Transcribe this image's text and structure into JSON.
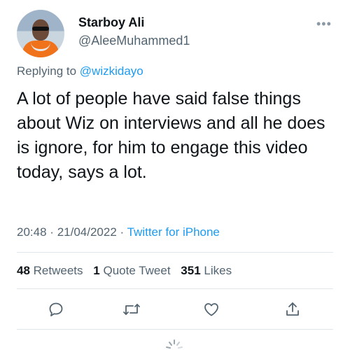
{
  "tweet": {
    "author": {
      "display_name": "Starboy Ali",
      "handle": "@AleeMuhammed1"
    },
    "replying_to": {
      "prefix": "Replying to",
      "mention": "@wizkidayo"
    },
    "text": "A lot of people have said false things about Wiz on interviews and all he does is ignore, for him to engage this video today, says a lot.",
    "time": "20:48",
    "date": "21/04/2022",
    "separator": "·",
    "source": "Twitter for iPhone"
  },
  "stats": {
    "retweets_count": "48",
    "retweets_label": "Retweets",
    "quotes_count": "1",
    "quotes_label": "Quote Tweet",
    "likes_count": "351",
    "likes_label": "Likes"
  },
  "actions": [
    {
      "icon": "reply-icon"
    },
    {
      "icon": "retweet-icon"
    },
    {
      "icon": "like-icon"
    },
    {
      "icon": "share-icon"
    }
  ],
  "colors": {
    "accent": "#1d9bf0",
    "text": "#0f1419",
    "secondary": "#536471"
  }
}
